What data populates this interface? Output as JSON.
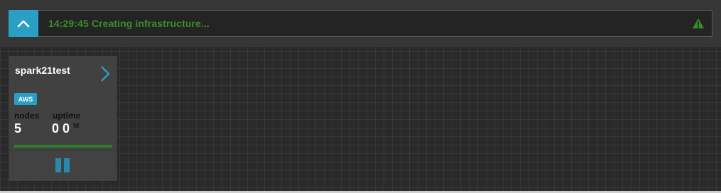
{
  "status_bar": {
    "message": "14:29:45 Creating infrastructure...",
    "message_color": "#3b8e2a",
    "toggle_icon": "chevron-up-icon",
    "warning_icon": "warning-triangle-icon",
    "accent": "#2a9fc4"
  },
  "cluster_card": {
    "name": "spark21test",
    "provider": "AWS",
    "nodes_label": "nodes",
    "nodes_value": "5",
    "uptime_label": "uptime",
    "uptime_value": "0 0",
    "uptime_unit": "M",
    "progress": 1.0,
    "progress_color": "#2f7f2a",
    "open_icon": "chevron-right-icon",
    "action_icon": "pause-icon"
  }
}
